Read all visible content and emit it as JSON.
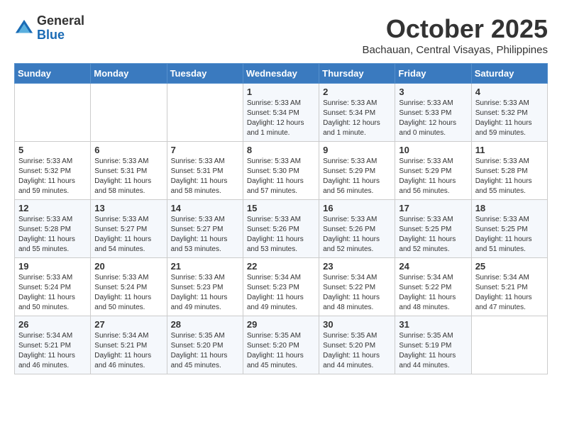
{
  "header": {
    "logo": {
      "general": "General",
      "blue": "Blue"
    },
    "month_title": "October 2025",
    "subtitle": "Bachauan, Central Visayas, Philippines"
  },
  "weekdays": [
    "Sunday",
    "Monday",
    "Tuesday",
    "Wednesday",
    "Thursday",
    "Friday",
    "Saturday"
  ],
  "weeks": [
    [
      {
        "day": "",
        "info": ""
      },
      {
        "day": "",
        "info": ""
      },
      {
        "day": "",
        "info": ""
      },
      {
        "day": "1",
        "info": "Sunrise: 5:33 AM\nSunset: 5:34 PM\nDaylight: 12 hours\nand 1 minute."
      },
      {
        "day": "2",
        "info": "Sunrise: 5:33 AM\nSunset: 5:34 PM\nDaylight: 12 hours\nand 1 minute."
      },
      {
        "day": "3",
        "info": "Sunrise: 5:33 AM\nSunset: 5:33 PM\nDaylight: 12 hours\nand 0 minutes."
      },
      {
        "day": "4",
        "info": "Sunrise: 5:33 AM\nSunset: 5:32 PM\nDaylight: 11 hours\nand 59 minutes."
      }
    ],
    [
      {
        "day": "5",
        "info": "Sunrise: 5:33 AM\nSunset: 5:32 PM\nDaylight: 11 hours\nand 59 minutes."
      },
      {
        "day": "6",
        "info": "Sunrise: 5:33 AM\nSunset: 5:31 PM\nDaylight: 11 hours\nand 58 minutes."
      },
      {
        "day": "7",
        "info": "Sunrise: 5:33 AM\nSunset: 5:31 PM\nDaylight: 11 hours\nand 58 minutes."
      },
      {
        "day": "8",
        "info": "Sunrise: 5:33 AM\nSunset: 5:30 PM\nDaylight: 11 hours\nand 57 minutes."
      },
      {
        "day": "9",
        "info": "Sunrise: 5:33 AM\nSunset: 5:29 PM\nDaylight: 11 hours\nand 56 minutes."
      },
      {
        "day": "10",
        "info": "Sunrise: 5:33 AM\nSunset: 5:29 PM\nDaylight: 11 hours\nand 56 minutes."
      },
      {
        "day": "11",
        "info": "Sunrise: 5:33 AM\nSunset: 5:28 PM\nDaylight: 11 hours\nand 55 minutes."
      }
    ],
    [
      {
        "day": "12",
        "info": "Sunrise: 5:33 AM\nSunset: 5:28 PM\nDaylight: 11 hours\nand 55 minutes."
      },
      {
        "day": "13",
        "info": "Sunrise: 5:33 AM\nSunset: 5:27 PM\nDaylight: 11 hours\nand 54 minutes."
      },
      {
        "day": "14",
        "info": "Sunrise: 5:33 AM\nSunset: 5:27 PM\nDaylight: 11 hours\nand 53 minutes."
      },
      {
        "day": "15",
        "info": "Sunrise: 5:33 AM\nSunset: 5:26 PM\nDaylight: 11 hours\nand 53 minutes."
      },
      {
        "day": "16",
        "info": "Sunrise: 5:33 AM\nSunset: 5:26 PM\nDaylight: 11 hours\nand 52 minutes."
      },
      {
        "day": "17",
        "info": "Sunrise: 5:33 AM\nSunset: 5:25 PM\nDaylight: 11 hours\nand 52 minutes."
      },
      {
        "day": "18",
        "info": "Sunrise: 5:33 AM\nSunset: 5:25 PM\nDaylight: 11 hours\nand 51 minutes."
      }
    ],
    [
      {
        "day": "19",
        "info": "Sunrise: 5:33 AM\nSunset: 5:24 PM\nDaylight: 11 hours\nand 50 minutes."
      },
      {
        "day": "20",
        "info": "Sunrise: 5:33 AM\nSunset: 5:24 PM\nDaylight: 11 hours\nand 50 minutes."
      },
      {
        "day": "21",
        "info": "Sunrise: 5:33 AM\nSunset: 5:23 PM\nDaylight: 11 hours\nand 49 minutes."
      },
      {
        "day": "22",
        "info": "Sunrise: 5:34 AM\nSunset: 5:23 PM\nDaylight: 11 hours\nand 49 minutes."
      },
      {
        "day": "23",
        "info": "Sunrise: 5:34 AM\nSunset: 5:22 PM\nDaylight: 11 hours\nand 48 minutes."
      },
      {
        "day": "24",
        "info": "Sunrise: 5:34 AM\nSunset: 5:22 PM\nDaylight: 11 hours\nand 48 minutes."
      },
      {
        "day": "25",
        "info": "Sunrise: 5:34 AM\nSunset: 5:21 PM\nDaylight: 11 hours\nand 47 minutes."
      }
    ],
    [
      {
        "day": "26",
        "info": "Sunrise: 5:34 AM\nSunset: 5:21 PM\nDaylight: 11 hours\nand 46 minutes."
      },
      {
        "day": "27",
        "info": "Sunrise: 5:34 AM\nSunset: 5:21 PM\nDaylight: 11 hours\nand 46 minutes."
      },
      {
        "day": "28",
        "info": "Sunrise: 5:35 AM\nSunset: 5:20 PM\nDaylight: 11 hours\nand 45 minutes."
      },
      {
        "day": "29",
        "info": "Sunrise: 5:35 AM\nSunset: 5:20 PM\nDaylight: 11 hours\nand 45 minutes."
      },
      {
        "day": "30",
        "info": "Sunrise: 5:35 AM\nSunset: 5:20 PM\nDaylight: 11 hours\nand 44 minutes."
      },
      {
        "day": "31",
        "info": "Sunrise: 5:35 AM\nSunset: 5:19 PM\nDaylight: 11 hours\nand 44 minutes."
      },
      {
        "day": "",
        "info": ""
      }
    ]
  ]
}
